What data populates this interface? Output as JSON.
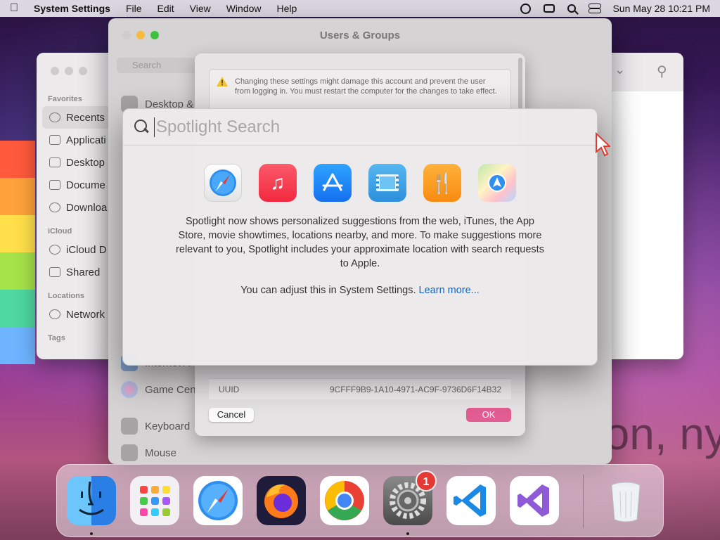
{
  "menubar": {
    "app_name": "System Settings",
    "items": [
      "File",
      "Edit",
      "View",
      "Window",
      "Help"
    ],
    "clock": "Sun May 28  10:21 PM"
  },
  "finder": {
    "sections": [
      {
        "title": "Favorites",
        "items": [
          "Recents",
          "Applicati",
          "Desktop",
          "Docume",
          "Downloa"
        ]
      },
      {
        "title": "iCloud",
        "items": [
          "iCloud D",
          "Shared"
        ]
      },
      {
        "title": "Locations",
        "items": [
          "Network"
        ]
      },
      {
        "title": "Tags",
        "items": []
      }
    ]
  },
  "settings": {
    "title": "Users & Groups",
    "search_placeholder": "Search",
    "sidebar_items": [
      "Desktop &",
      "Internet A",
      "Game Cen",
      "Keyboard",
      "Mouse"
    ]
  },
  "sheet": {
    "warning": "Changing these settings might damage this account and prevent the user from logging in. You must restart the computer for the changes to take effect.",
    "uuid_label": "UUID",
    "uuid_value": "9CFFF9B9-1A10-4971-AC9F-9736D6F14B32",
    "cancel_label": "Cancel",
    "ok_label": "OK"
  },
  "spotlight": {
    "placeholder": "Spotlight Search",
    "app_icons": [
      "safari-icon",
      "music-icon",
      "app-store-icon",
      "movies-icon",
      "restaurants-icon",
      "maps-icon"
    ],
    "body_text": "Spotlight now shows personalized suggestions from the web, iTunes, the App Store, movie showtimes, locations nearby, and more. To make suggestions more relevant to you, Spotlight includes your approximate location with search requests to Apple.",
    "adjust_text": "You can adjust this in System Settings.",
    "learn_more": "Learn more..."
  },
  "dock": {
    "apps": [
      "Finder",
      "Launchpad",
      "Safari",
      "Firefox",
      "Chrome",
      "System Settings",
      "Visual Studio Code",
      "Visual Studio",
      "Trash"
    ],
    "settings_badge": "1"
  },
  "watermark": "on, ny",
  "colors": {
    "accent_pink": "#e15d92",
    "link_blue": "#1463c8",
    "badge_red": "#e53935"
  }
}
